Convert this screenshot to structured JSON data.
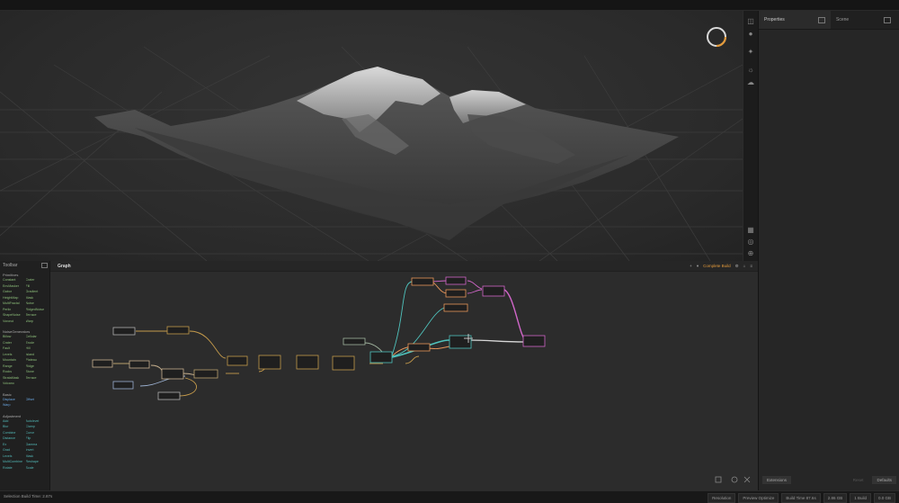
{
  "library": {
    "title": "Toolbar",
    "sections": [
      {
        "name": "Primitives",
        "items": [
          "Constant",
          "Crater",
          "EnvMasker",
          "Fill",
          "Gabor",
          "Gradient",
          "HeightMap",
          "Mask",
          "MultiFractal",
          "Noise",
          "Perlin",
          "RidgedNoise",
          "ShapeNoise",
          "Terrace",
          "Voronoi",
          "Warp"
        ]
      },
      {
        "name": "NoiseGenerators",
        "items": [
          "Billow",
          "Cellular",
          "Crater",
          "Erode",
          "Fault",
          "Hill",
          "Levels",
          "Island",
          "Mountain",
          "Plateau",
          "Range",
          "Ridge",
          "Rocks",
          "Stone",
          "StrataMask",
          "Terrace",
          "Volcano"
        ]
      },
      {
        "name": "Basic",
        "items": [
          "Displace",
          "Offset",
          "Warp"
        ]
      },
      {
        "name": "Adjustment",
        "items": [
          "Add",
          "Autolevel",
          "Blur",
          "Clamp",
          "Combine",
          "Curve",
          "Distance",
          "Flip",
          "Ex",
          "Gamma",
          "Grad",
          "Invert",
          "Levels",
          "Mask",
          "MultiCombine",
          "Reshape",
          "Rotate",
          "Scale"
        ]
      }
    ]
  },
  "graph": {
    "tab_label": "Graph",
    "dropdown_label": "Complete Build"
  },
  "right_panel": {
    "tab1_label": "Properties",
    "tab2_label": "Scene",
    "footer_left": "Extensions",
    "footer_mid": "Reset",
    "footer_right": "Defaults"
  },
  "status": {
    "left_text": "Selection Build Time: 2.87s",
    "items": [
      "Resolution",
      "Preview Optimize",
      "Build Time 87.6s",
      "2.86 GB",
      "1 Build",
      "0.0 GB"
    ]
  },
  "colors": {
    "accent_orange": "#e39a3b",
    "viewport_bg": "#2f2f2f",
    "graph_bg": "#2c2c2c",
    "node_teal": "#4fc3bd",
    "node_pink": "#d066c8",
    "node_orange": "#e8965a"
  },
  "icons": [
    "loading-ring-icon",
    "camera-icon",
    "person-icon",
    "sun-icon",
    "cloud-icon",
    "grid-icon",
    "globe-icon",
    "zoom-fit-icon",
    "refresh-icon",
    "move-cursor-icon"
  ]
}
